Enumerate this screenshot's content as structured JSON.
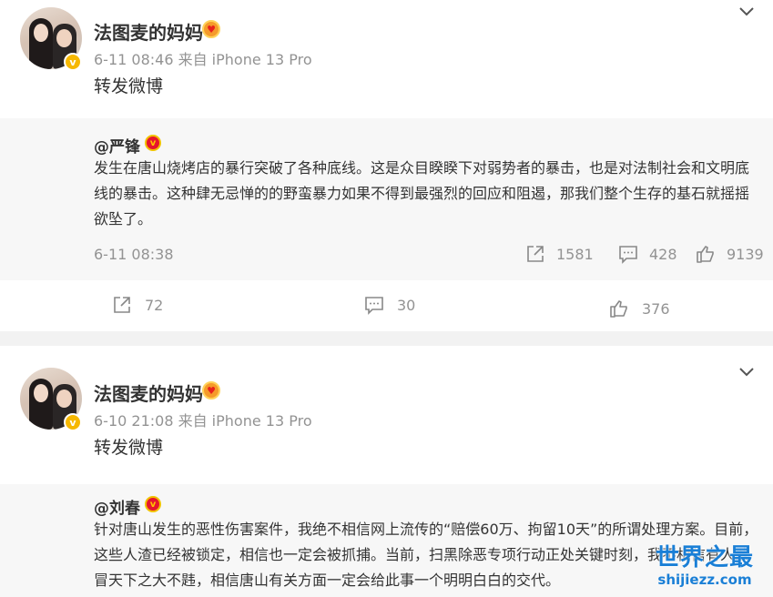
{
  "posts": [
    {
      "username": "法图麦的妈妈",
      "meta": "6-11 08:46  来自 iPhone 13 Pro",
      "text": "转发微博",
      "repost": {
        "username": "@严锋",
        "text": "发生在唐山烧烤店的暴行突破了各种底线。这是众目睽睽下对弱势者的暴击，也是对法制社会和文明底线的暴击。这种肆无忌惮的的野蛮暴力如果不得到最强烈的回应和阻遏，那我们整个生存的基石就摇摇欲坠了。",
        "time": "6-11 08:38",
        "shares": "1581",
        "comments": "428",
        "likes": "9139"
      },
      "actions": {
        "shares": "72",
        "comments": "30",
        "likes": "376"
      }
    },
    {
      "username": "法图麦的妈妈",
      "meta": "6-10 21:08  来自 iPhone 13 Pro",
      "text": "转发微博",
      "repost": {
        "username": "@刘春",
        "text": "针对唐山发生的恶性伤害案件，我绝不相信网上流传的“赔偿60万、拘留10天”的所谓处理方案。目前，这些人渣已经被锁定，相信也一定会被抓捕。当前，扫黑除恶专项行动正处关键时刻，我不相信有人敢冒天下之大不韪，相信唐山有关方面一定会给此事一个明明白白的交代。"
      }
    }
  ],
  "watermark": {
    "main": "世界之最",
    "sub": "shijiezz.com"
  },
  "icons": {
    "verified_badge": "v",
    "crown": "crown-icon",
    "share": "share-icon",
    "comment": "comment-icon",
    "like": "like-icon",
    "chevron": "chevron-down-icon"
  },
  "colors": {
    "verified_yellow": "#f6b800",
    "verified_red": "#e6162d",
    "repost_bg": "#f7f7f7",
    "meta_gray": "#939393",
    "watermark_blue": "#1a7fd6"
  }
}
